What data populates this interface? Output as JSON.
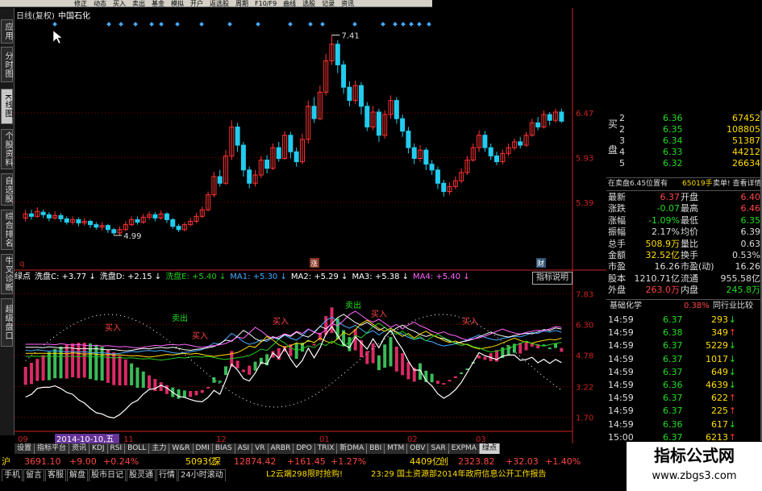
{
  "menu": [
    "修正",
    "动态",
    "买入",
    "卖出",
    "基金",
    "模拟",
    "开户",
    "返选股",
    "周期",
    "F10/F9",
    "曲线",
    "选股",
    "记录",
    "资讯"
  ],
  "sidebar": [
    "应用",
    "分时图",
    "K线图",
    "个股资料",
    "自选股",
    "综合排名",
    "牛叉诊断",
    "超级盘口"
  ],
  "chart_title": "日线(复权)",
  "stock_name": "中国石化",
  "price_axis": [
    "6.47",
    "5.93",
    "5.39"
  ],
  "ind_axis": [
    "7.83",
    "6.30",
    "4.78",
    "3.22",
    "1.70"
  ],
  "x_labels": [
    "09",
    "2014-10-10,五",
    "11",
    "12",
    "01",
    "02",
    "03"
  ],
  "annotations": {
    "high": "7.41",
    "low": "4.99"
  },
  "markers": {
    "q": "q",
    "zhang": "涨",
    "cai": "财"
  },
  "indicator": {
    "legend": [
      {
        "name": "绿点",
        "color": "#ffffff"
      },
      {
        "name": "洗盘C: +3.77 ↓",
        "color": "#ffffff"
      },
      {
        "name": "洗盘D: +2.15 ↓",
        "color": "#ffffff"
      },
      {
        "name": "洗盘E: +5.40 ↓",
        "color": "#22cc22"
      },
      {
        "name": "MA1: +5.30 ↓",
        "color": "#44aaff"
      },
      {
        "name": "MA2: +5.29 ↓",
        "color": "#ffffff"
      },
      {
        "name": "MA3: +5.38 ↓",
        "color": "#ffffff"
      },
      {
        "name": "MA4: +5.40 ↓",
        "color": "#ff66ff"
      }
    ],
    "help": "指标说明",
    "buy": "买入",
    "sell": "卖出"
  },
  "order_book": {
    "side_label_buy": "买",
    "side_label_pan": "盘",
    "levels": [
      {
        "n": "2",
        "p": "6.36",
        "v": "67452"
      },
      {
        "n": "2",
        "p": "6.35",
        "v": "108805"
      },
      {
        "n": "3",
        "p": "6.34",
        "v": "51387"
      },
      {
        "n": "4",
        "p": "6.33",
        "v": "44212"
      },
      {
        "n": "5",
        "p": "6.32",
        "v": "26634"
      }
    ]
  },
  "notice": {
    "text": "在卖盘6.45位置有",
    "qty": "65019手",
    "link": "卖单! 查看详情"
  },
  "stats": [
    {
      "l1": "最新",
      "v1": "6.37",
      "l2": "开盘",
      "v2": "6.40",
      "c1": "#ff4444",
      "c2": "#ff4444"
    },
    {
      "l1": "涨跌",
      "v1": "-0.07",
      "l2": "最高",
      "v2": "6.46",
      "c1": "#22dd22",
      "c2": "#ff4444"
    },
    {
      "l1": "涨幅",
      "v1": "-1.09%",
      "l2": "最低",
      "v2": "6.35",
      "c1": "#22dd22",
      "c2": "#22dd22"
    },
    {
      "l1": "振幅",
      "v1": "2.17%",
      "l2": "均价",
      "v2": "6.39",
      "c1": "#dddddd",
      "c2": "#dddddd"
    },
    {
      "l1": "总手",
      "v1": "508.9万",
      "l2": "量比",
      "v2": "0.63",
      "c1": "#ffdd00",
      "c2": "#dddddd"
    },
    {
      "l1": "金额",
      "v1": "32.52亿",
      "l2": "换手",
      "v2": "0.53%",
      "c1": "#ffdd00",
      "c2": "#dddddd"
    },
    {
      "l1": "市盈",
      "v1": "16.26",
      "l2": "市盈(动)",
      "v2": "16.26",
      "c1": "#dddddd",
      "c2": "#dddddd"
    },
    {
      "l1": "股本",
      "v1": "1210.71亿",
      "l2": "流通",
      "v2": "955.58亿",
      "c1": "#dddddd",
      "c2": "#dddddd"
    },
    {
      "l1": "外盘",
      "v1": "263.0万",
      "l2": "内盘",
      "v2": "245.8万",
      "c1": "#ff4444",
      "c2": "#22dd22"
    }
  ],
  "sector": {
    "name": "基础化学",
    "change": "0.38%",
    "compare": "同行业比较"
  },
  "ticks": [
    {
      "t": "14:59",
      "p": "6.37",
      "v": "293",
      "up": false
    },
    {
      "t": "14:59",
      "p": "6.38",
      "v": "349",
      "up": true
    },
    {
      "t": "14:59",
      "p": "6.37",
      "v": "5229",
      "up": false
    },
    {
      "t": "14:59",
      "p": "6.37",
      "v": "1017",
      "up": false
    },
    {
      "t": "14:59",
      "p": "6.37",
      "v": "649",
      "up": false
    },
    {
      "t": "14:59",
      "p": "6.36",
      "v": "4639",
      "up": false
    },
    {
      "t": "14:59",
      "p": "6.37",
      "v": "622",
      "up": true
    },
    {
      "t": "14:59",
      "p": "6.37",
      "v": "225",
      "up": true
    },
    {
      "t": "14:59",
      "p": "6.36",
      "v": "617",
      "up": false
    },
    {
      "t": "15:00",
      "p": "6.37",
      "v": "6213",
      "up": true
    }
  ],
  "tabs": [
    "设置",
    "指标平台",
    "资讯",
    "KDJ",
    "RSI",
    "BOLL",
    "主力",
    "W&R",
    "DMI",
    "BIAS",
    "ASI",
    "VR",
    "ARBR",
    "DPO",
    "TRIX",
    "新DMA",
    "BBI",
    "MTM",
    "OBV",
    "SAR",
    "EXPMA",
    "绿点"
  ],
  "active_tab": "绿点",
  "index_bar": [
    {
      "t": "沪",
      "c": "#ffdd00"
    },
    {
      "t": "3691.10",
      "c": "#ff4444"
    },
    {
      "t": "+9.00",
      "c": "#ff4444"
    },
    {
      "t": "+0.24%",
      "c": "#ff4444"
    },
    {
      "t": "5093亿",
      "c": "#ffdd00"
    },
    {
      "t": "深",
      "c": "#ffdd00"
    },
    {
      "t": "12874.42",
      "c": "#ff4444"
    },
    {
      "t": "+161.45",
      "c": "#ff4444"
    },
    {
      "t": "+1.27%",
      "c": "#ff4444"
    },
    {
      "t": "4409亿",
      "c": "#ffdd00"
    },
    {
      "t": "创",
      "c": "#ffdd00"
    },
    {
      "t": "2323.82",
      "c": "#ff4444"
    },
    {
      "t": "+32.03",
      "c": "#ff4444"
    },
    {
      "t": "+1.40%",
      "c": "#ff4444"
    }
  ],
  "bottom_buttons": [
    "手机",
    "留言",
    "客服",
    "解盘",
    "股市日记",
    "股灵通",
    "行情",
    "24小时滚动"
  ],
  "ticker_text1": "L2云端298限时抢购!",
  "ticker_time": "23:29",
  "ticker_text2": "国土资源部2014年政府信息公开工作报告",
  "watermark": {
    "title": "指标公式网",
    "url": "www.zbgs3.com"
  },
  "colors": {
    "up": "#ff3333",
    "down": "#22ccee",
    "grid": "#8b0000",
    "axis": "#cc2222",
    "green": "#22dd22"
  },
  "chart_data": {
    "type": "candlestick",
    "ylim": [
      4.6,
      7.6
    ],
    "candles": [
      [
        5.2,
        5.25,
        5.3,
        5.16
      ],
      [
        5.25,
        5.22,
        5.3,
        5.18
      ],
      [
        5.22,
        5.28,
        5.33,
        5.2
      ],
      [
        5.27,
        5.24,
        5.3,
        5.2
      ],
      [
        5.24,
        5.2,
        5.27,
        5.16
      ],
      [
        5.2,
        5.23,
        5.28,
        5.18
      ],
      [
        5.23,
        5.19,
        5.26,
        5.15
      ],
      [
        5.19,
        5.15,
        5.22,
        5.12
      ],
      [
        5.15,
        5.18,
        5.22,
        5.12
      ],
      [
        5.18,
        5.14,
        5.21,
        5.1
      ],
      [
        5.14,
        5.16,
        5.2,
        5.11
      ],
      [
        5.16,
        5.12,
        5.18,
        5.08
      ],
      [
        5.12,
        5.09,
        5.15,
        5.06
      ],
      [
        5.09,
        5.11,
        5.15,
        5.05
      ],
      [
        5.11,
        5.06,
        5.13,
        5.02
      ],
      [
        5.06,
        5.02,
        5.08,
        4.99
      ],
      [
        5.02,
        5.06,
        5.1,
        4.99
      ],
      [
        5.06,
        5.12,
        5.16,
        5.04
      ],
      [
        5.12,
        5.18,
        5.22,
        5.1
      ],
      [
        5.18,
        5.15,
        5.22,
        5.12
      ],
      [
        5.15,
        5.21,
        5.25,
        5.13
      ],
      [
        5.21,
        5.24,
        5.28,
        5.18
      ],
      [
        5.24,
        5.2,
        5.27,
        5.16
      ],
      [
        5.2,
        5.25,
        5.29,
        5.18
      ],
      [
        5.25,
        5.18,
        5.27,
        5.14
      ],
      [
        5.18,
        5.1,
        5.2,
        5.07
      ],
      [
        5.1,
        5.06,
        5.13,
        5.03
      ],
      [
        5.06,
        5.12,
        5.15,
        5.04
      ],
      [
        5.12,
        5.16,
        5.2,
        5.1
      ],
      [
        5.16,
        5.22,
        5.26,
        5.14
      ],
      [
        5.22,
        5.3,
        5.34,
        5.2
      ],
      [
        5.3,
        5.48,
        5.52,
        5.28
      ],
      [
        5.48,
        5.7,
        5.76,
        5.45
      ],
      [
        5.7,
        5.62,
        5.78,
        5.58
      ],
      [
        5.62,
        5.95,
        6.02,
        5.6
      ],
      [
        5.95,
        6.3,
        6.38,
        5.9
      ],
      [
        6.3,
        6.08,
        6.35,
        6.0
      ],
      [
        6.08,
        5.78,
        6.12,
        5.7
      ],
      [
        5.78,
        5.62,
        5.82,
        5.56
      ],
      [
        5.62,
        5.72,
        5.78,
        5.58
      ],
      [
        5.72,
        5.9,
        5.95,
        5.68
      ],
      [
        5.9,
        5.8,
        5.96,
        5.74
      ],
      [
        5.8,
        6.05,
        6.1,
        5.78
      ],
      [
        6.05,
        5.92,
        6.12,
        5.88
      ],
      [
        5.92,
        6.2,
        6.25,
        5.9
      ],
      [
        6.2,
        6.0,
        6.24,
        5.92
      ],
      [
        6.0,
        5.88,
        6.05,
        5.82
      ],
      [
        5.88,
        6.15,
        6.22,
        5.85
      ],
      [
        6.15,
        6.55,
        6.62,
        6.1
      ],
      [
        6.55,
        6.4,
        6.66,
        6.35
      ],
      [
        6.4,
        6.72,
        6.8,
        6.38
      ],
      [
        6.72,
        7.1,
        7.18,
        6.68
      ],
      [
        7.1,
        7.3,
        7.41,
        7.05
      ],
      [
        7.3,
        7.05,
        7.35,
        6.95
      ],
      [
        7.05,
        6.78,
        7.1,
        6.7
      ],
      [
        6.78,
        6.62,
        6.85,
        6.55
      ],
      [
        6.62,
        6.8,
        6.86,
        6.58
      ],
      [
        6.8,
        6.55,
        6.84,
        6.45
      ],
      [
        6.55,
        6.3,
        6.6,
        6.25
      ],
      [
        6.3,
        6.48,
        6.55,
        6.26
      ],
      [
        6.48,
        6.2,
        6.52,
        6.12
      ],
      [
        6.2,
        6.45,
        6.5,
        6.16
      ],
      [
        6.45,
        6.62,
        6.68,
        6.4
      ],
      [
        6.62,
        6.4,
        6.66,
        6.34
      ],
      [
        6.4,
        6.25,
        6.45,
        6.18
      ],
      [
        6.25,
        6.05,
        6.3,
        5.98
      ],
      [
        6.05,
        5.92,
        6.1,
        5.85
      ],
      [
        5.92,
        6.02,
        6.08,
        5.88
      ],
      [
        6.02,
        5.85,
        6.05,
        5.78
      ],
      [
        5.85,
        5.78,
        5.9,
        5.72
      ],
      [
        5.78,
        5.62,
        5.82,
        5.55
      ],
      [
        5.62,
        5.52,
        5.66,
        5.46
      ],
      [
        5.52,
        5.58,
        5.63,
        5.48
      ],
      [
        5.58,
        5.65,
        5.7,
        5.55
      ],
      [
        5.65,
        5.75,
        5.8,
        5.62
      ],
      [
        5.75,
        5.9,
        5.95,
        5.72
      ],
      [
        5.9,
        6.05,
        6.1,
        5.88
      ],
      [
        6.05,
        6.2,
        6.26,
        6.0
      ],
      [
        6.2,
        6.05,
        6.25,
        6.0
      ],
      [
        6.05,
        5.95,
        6.1,
        5.9
      ],
      [
        5.95,
        5.88,
        6.0,
        5.84
      ],
      [
        5.88,
        5.98,
        6.03,
        5.85
      ],
      [
        5.98,
        6.05,
        6.1,
        5.95
      ],
      [
        6.05,
        6.12,
        6.16,
        6.02
      ],
      [
        6.12,
        6.08,
        6.18,
        6.04
      ],
      [
        6.08,
        6.2,
        6.24,
        6.06
      ],
      [
        6.2,
        6.35,
        6.4,
        6.18
      ],
      [
        6.35,
        6.3,
        6.42,
        6.26
      ],
      [
        6.3,
        6.45,
        6.5,
        6.28
      ],
      [
        6.45,
        6.38,
        6.48,
        6.32
      ],
      [
        6.38,
        6.48,
        6.52,
        6.35
      ],
      [
        6.48,
        6.37,
        6.52,
        6.35
      ]
    ],
    "note": "each candle: [open, close, high, low]"
  }
}
